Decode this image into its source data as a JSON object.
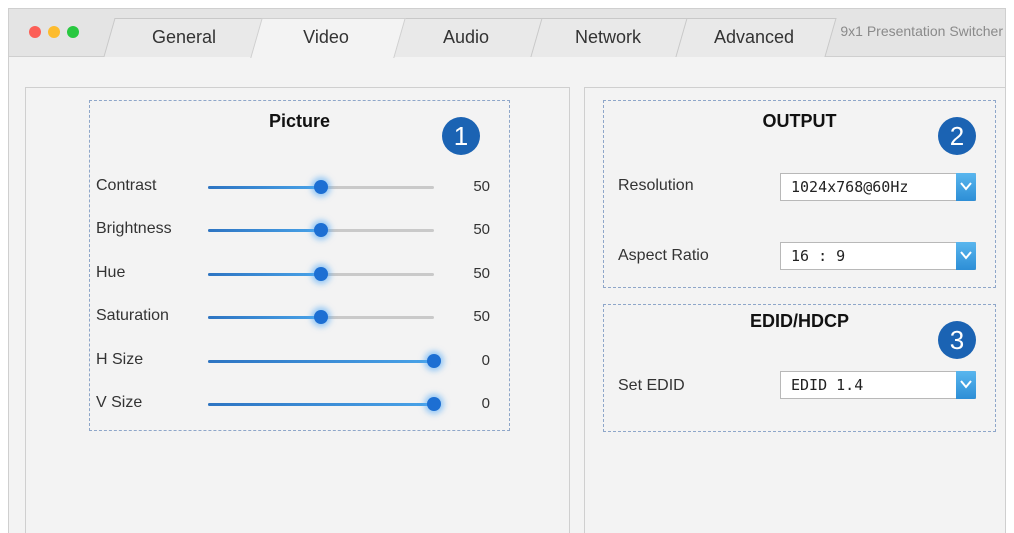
{
  "window": {
    "app_title": "9x1 Presentation Switcher",
    "tabs": [
      {
        "label": "General"
      },
      {
        "label": "Video"
      },
      {
        "label": "Audio"
      },
      {
        "label": "Network"
      },
      {
        "label": "Advanced"
      }
    ],
    "active_tab": "Video"
  },
  "picture": {
    "title": "Picture",
    "badge": "1",
    "sliders": [
      {
        "label": "Contrast",
        "value": "50",
        "fill_fraction": 0.5
      },
      {
        "label": "Brightness",
        "value": "50",
        "fill_fraction": 0.5
      },
      {
        "label": "Hue",
        "value": "50",
        "fill_fraction": 0.5
      },
      {
        "label": "Saturation",
        "value": "50",
        "fill_fraction": 0.5
      },
      {
        "label": "H Size",
        "value": "0",
        "fill_fraction": 1.0
      },
      {
        "label": "V Size",
        "value": "0",
        "fill_fraction": 1.0
      }
    ]
  },
  "output": {
    "title": "OUTPUT",
    "badge": "2",
    "resolution_label": "Resolution",
    "resolution_value": "1024x768@60Hz",
    "aspect_label": "Aspect Ratio",
    "aspect_value": "16 : 9"
  },
  "edid": {
    "title": "EDID/HDCP",
    "badge": "3",
    "set_edid_label": "Set EDID",
    "set_edid_value": "EDID 1.4"
  },
  "colors": {
    "accent": "#1b63b3",
    "slider_thumb": "#1d6fd3",
    "dropdown_button": "#2d8ed6",
    "group_border": "#8ea6c9"
  }
}
